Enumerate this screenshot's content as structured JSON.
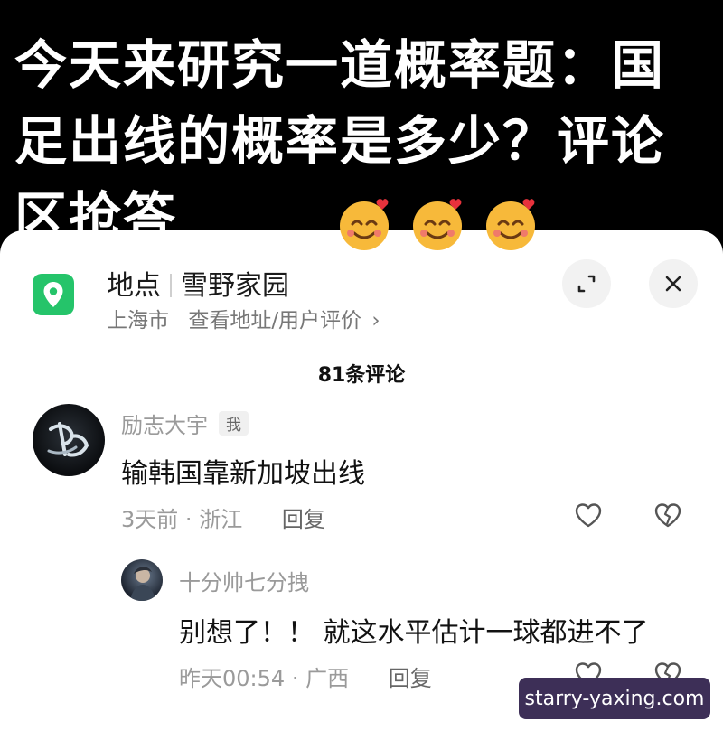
{
  "banner": {
    "text": "今天来研究一道概率题：国足出线的概率是多少？评论区抢答"
  },
  "location": {
    "label": "地点",
    "name": "雪野家园",
    "city": "上海市",
    "link": "查看地址/用户评价",
    "chevron": "›",
    "icon": "map-pin-icon",
    "accent": "#25c46a"
  },
  "comments_count": "81条评论",
  "comments": [
    {
      "user": "励志大宇",
      "badge": "我",
      "text": "输韩国靠新加坡出线",
      "time": "3天前",
      "region": "浙江",
      "reply_label": "回复"
    },
    {
      "user": "十分帅七分拽",
      "text": "别想了！！ 就这水平估计一球都进不了",
      "time": "昨天00:54",
      "region": "广西",
      "reply_label": "回复"
    }
  ],
  "meta_separator": "·",
  "watermark": "starry-yaxing.com"
}
